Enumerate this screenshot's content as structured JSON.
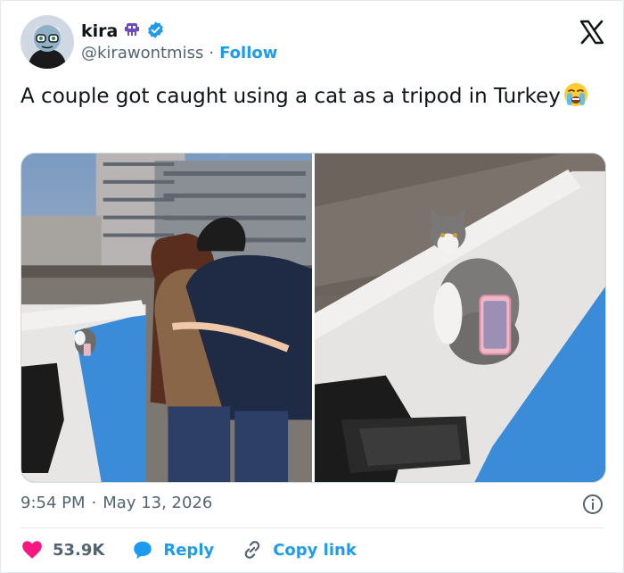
{
  "user": {
    "display_name": "kira",
    "handle": "@kirawontmiss",
    "separator": "·",
    "follow_label": "Follow"
  },
  "tweet": {
    "text": "A couple got caught using a cat as a tripod in Turkey",
    "emoji": "loudly-crying-face"
  },
  "meta": {
    "time": "9:54 PM",
    "separator": "·",
    "date": "May 13, 2026"
  },
  "actions": {
    "likes": "53.9K",
    "reply_label": "Reply",
    "copy_link_label": "Copy link"
  },
  "colors": {
    "accent": "#1d9bf0",
    "like": "#f91880",
    "muted": "#536471",
    "verified": "#1d9bf0"
  },
  "icons": [
    "avatar",
    "alien-monster-emoji",
    "verified-badge-icon",
    "x-logo-icon",
    "info-icon",
    "heart-icon",
    "reply-bubble-icon",
    "link-icon"
  ]
}
